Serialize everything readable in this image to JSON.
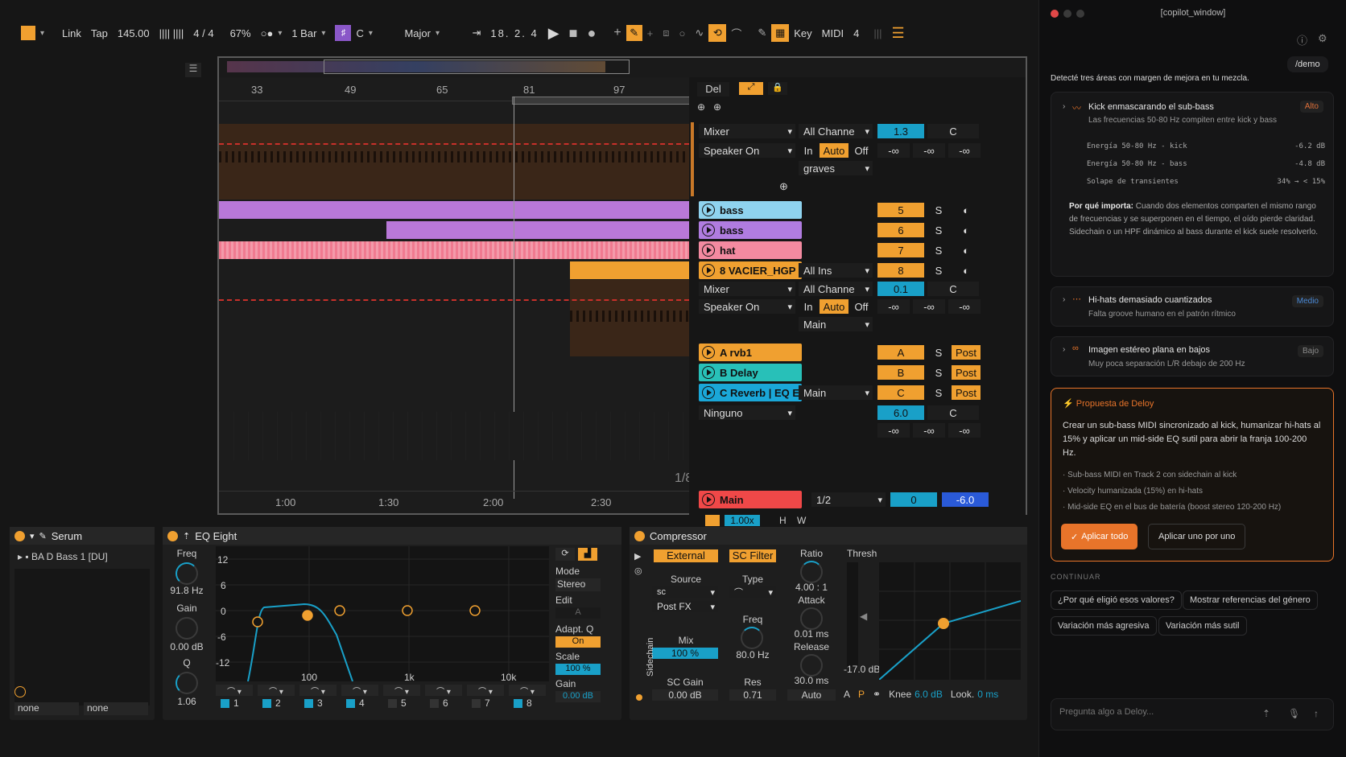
{
  "toolbar": {
    "link": "Link",
    "tap": "Tap",
    "tempo": "145.00",
    "sig": "4 / 4",
    "zoom": "67%",
    "quant": "1 Bar",
    "key": "C",
    "scale": "Major",
    "position": "18. 2. 4",
    "key_btn": "Key",
    "midi_btn": "MIDI",
    "midi_count": "4"
  },
  "ruler": {
    "bars": [
      "33",
      "49",
      "65",
      "81",
      "97"
    ],
    "times": [
      "1:00",
      "1:30",
      "2:00",
      "2:30"
    ],
    "grid": "1/8"
  },
  "session": {
    "del": "Del"
  },
  "tracks": [
    {
      "name": "bass",
      "num": "5",
      "s": "S",
      "color": "#8fd3ef"
    },
    {
      "name": "bass",
      "num": "6",
      "s": "S",
      "color": "#b07ce0"
    },
    {
      "name": "hat",
      "num": "7",
      "s": "S",
      "color": "#f38aa0"
    },
    {
      "name": "8 VACIER_HGP",
      "num": "8",
      "s": "S",
      "color": "#f0a030",
      "input": "All Ins"
    },
    {
      "name": "A rvb1",
      "num": "A",
      "s": "S",
      "post": "Post",
      "color": "#f0a030"
    },
    {
      "name": "B Delay",
      "num": "B",
      "s": "S",
      "post": "Post",
      "color": "#28c0b8"
    },
    {
      "name": "C Reverb | EQ E",
      "num": "C",
      "s": "S",
      "post": "Post",
      "color": "#1aa7d8",
      "output": "Main"
    }
  ],
  "io1": {
    "type": "Mixer",
    "channel": "All Channe",
    "mon": "Speaker On",
    "in": "In",
    "auto": "Auto",
    "off": "Off",
    "vol": "1.3",
    "pan": "C",
    "inf": "-∞",
    "route": "graves"
  },
  "io2": {
    "type": "Mixer",
    "channel": "All Channe",
    "mon": "Speaker On",
    "in": "In",
    "auto": "Auto",
    "off": "Off",
    "vol": "0.1",
    "pan": "C",
    "inf": "-∞",
    "route": "Main"
  },
  "ioc": {
    "send": "Ninguno",
    "vol": "6.0",
    "pan": "C",
    "inf": "-∞"
  },
  "master": {
    "name": "Main",
    "cue": "1/2",
    "vol": "0",
    "db": "-6.0",
    "speed": "1.00x",
    "h": "H",
    "w": "W"
  },
  "serum": {
    "title": "Serum",
    "preset": "BA D Bass 1 [DU]",
    "in": "none",
    "out": "none"
  },
  "eq": {
    "title": "EQ Eight",
    "freq_l": "Freq",
    "freq": "91.8 Hz",
    "gain_l": "Gain",
    "gain": "0.00 dB",
    "q_l": "Q",
    "q": "1.06",
    "y": [
      "12",
      "6",
      "0",
      "-6",
      "-12"
    ],
    "x": [
      "100",
      "1k",
      "10k"
    ],
    "mode_l": "Mode",
    "mode": "Stereo",
    "edit_l": "Edit",
    "edit": "A",
    "adapt_l": "Adapt. Q",
    "adapt": "On",
    "scale_l": "Scale",
    "scale": "100 %",
    "gain2_l": "Gain",
    "gain2": "0.00 dB",
    "bands": [
      "1",
      "2",
      "3",
      "4",
      "5",
      "6",
      "7",
      "8"
    ]
  },
  "comp": {
    "title": "Compressor",
    "external": "External",
    "scfilter": "SC Filter",
    "source_l": "Source",
    "source": "sc",
    "postfx": "Post FX",
    "type_l": "Type",
    "mix_l": "Mix",
    "mix": "100 %",
    "freq_l": "Freq",
    "freq": "80.0 Hz",
    "scgain_l": "SC Gain",
    "scgain": "0.00 dB",
    "res_l": "Res",
    "res": "0.71",
    "sidechain": "Sidechain",
    "ratio_l": "Ratio",
    "ratio": "4.00 : 1",
    "attack_l": "Attack",
    "attack": "0.01 ms",
    "release_l": "Release",
    "release": "30.0 ms",
    "auto": "Auto",
    "thresh_l": "Thresh",
    "thresh": "-17.0 dB",
    "knee_l": "Knee",
    "knee": "6.0 dB",
    "look_l": "Look.",
    "look": "0 ms",
    "a": "A",
    "p": "P"
  },
  "copilot": {
    "window_title": "[copilot_window]",
    "user_msg": "/demo",
    "intro": "Detecté tres áreas con margen de mejora en tu mezcla.",
    "issues": [
      {
        "title": "Kick enmascarando el sub-bass",
        "sub": "Las frecuencias 50-80 Hz compiten entre kick y bass",
        "badge": "Alto",
        "badge_color": "#e0703a",
        "metrics": [
          {
            "k": "Energía 50-80 Hz - kick",
            "v": "-6.2 dB"
          },
          {
            "k": "Energía 50-80 Hz - bass",
            "v": "-4.8 dB"
          },
          {
            "k": "Solape de transientes",
            "v": "34% → < 15%"
          }
        ],
        "why_l": "Por qué importa:",
        "why": "Cuando dos elementos comparten el mismo rango de frecuencias y se superponen en el tiempo, el oído pierde claridad. Sidechain o un HPF dinámico al bass durante el kick suele resolverlo."
      },
      {
        "title": "Hi-hats demasiado cuantizados",
        "sub": "Falta groove humano en el patrón rítmico",
        "badge": "Medio",
        "badge_color": "#4a8ad8"
      },
      {
        "title": "Imagen estéreo plana en bajos",
        "sub": "Muy poca separación L/R debajo de 200 Hz",
        "badge": "Bajo",
        "badge_color": "#8a8a8a"
      }
    ],
    "proposal": {
      "title": "Propuesta de Deloy",
      "body": "Crear un sub-bass MIDI sincronizado al kick, humanizar hi-hats al 15% y aplicar un mid-side EQ sutil para abrir la franja 100-200 Hz.",
      "items": [
        "Sub-bass MIDI en Track 2 con sidechain al kick",
        "Velocity humanizada (15%) en hi-hats",
        "Mid-side EQ en el bus de batería (boost stereo 120-200 Hz)"
      ],
      "apply_all": "Aplicar todo",
      "apply_one": "Aplicar uno por uno"
    },
    "continue_l": "CONTINUAR",
    "suggestions": [
      "¿Por qué eligió esos valores?",
      "Mostrar referencias del género",
      "Variación más agresiva",
      "Variación más sutil"
    ],
    "input_placeholder": "Pregunta algo a Deloy...",
    "accent": "#e8742a"
  }
}
